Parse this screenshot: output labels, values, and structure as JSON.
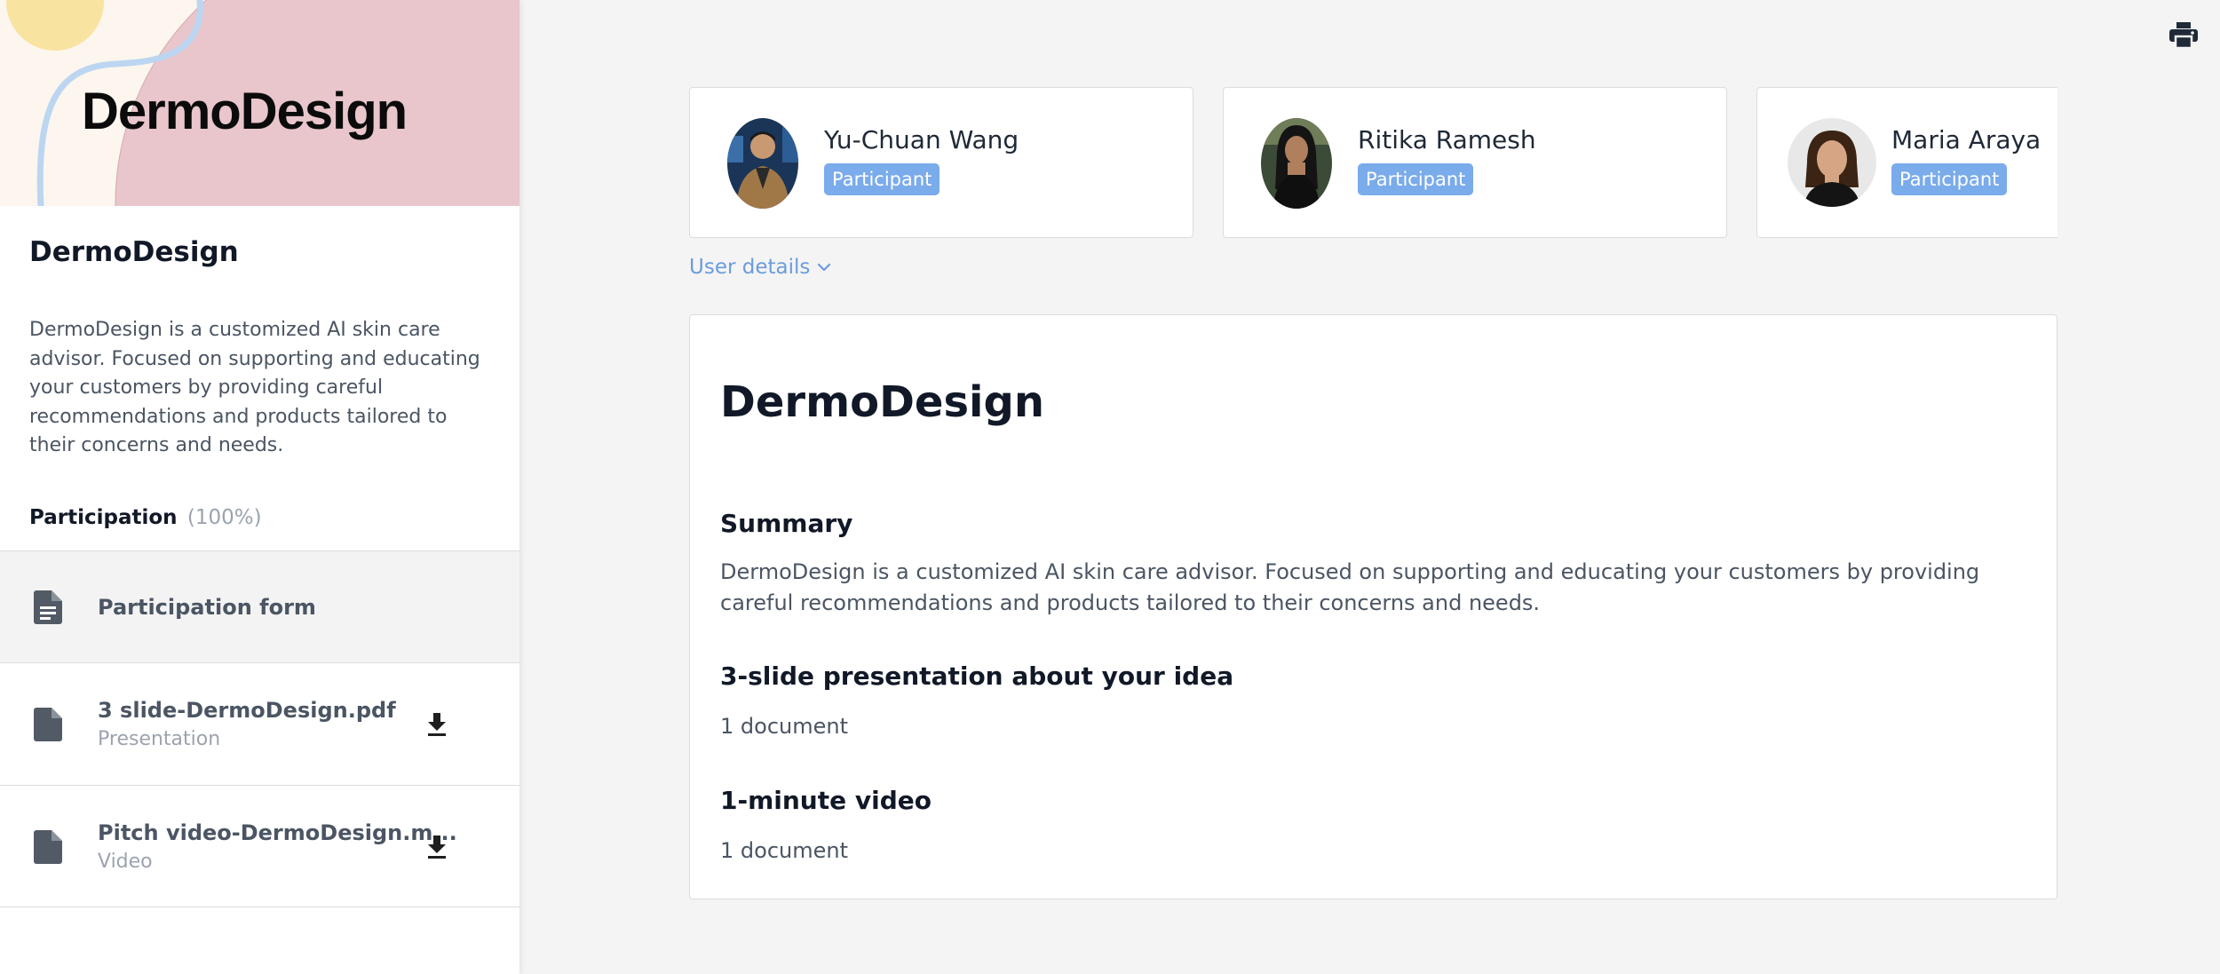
{
  "sidebar": {
    "hero_title": "DermoDesign",
    "title": "DermoDesign",
    "description": "DermoDesign is a customized AI skin care advisor. Focused on supporting and educating your customers by providing careful recommendations and products tailored to their concerns and needs.",
    "participation_label": "Participation",
    "participation_percent": "(100%)",
    "items": [
      {
        "title": "Participation form",
        "subtitle": "",
        "icon": "document-icon",
        "active": true
      },
      {
        "title": "3 slide-DermoDesign.pdf",
        "subtitle": "Presentation",
        "icon": "file-icon",
        "action_icon": "download-icon"
      },
      {
        "title": "Pitch video-DermoDesign.m...",
        "subtitle": "Video",
        "icon": "file-icon",
        "action_icon": "download-icon"
      }
    ]
  },
  "toolbar": {
    "print_icon": "print-icon"
  },
  "users": [
    {
      "name": "Yu-Chuan Wang",
      "role": "Participant"
    },
    {
      "name": "Ritika Ramesh",
      "role": "Participant"
    },
    {
      "name": "Maria Araya",
      "role": "Participant"
    }
  ],
  "user_details_label": "User details",
  "main": {
    "title": "DermoDesign",
    "sections": [
      {
        "heading": "Summary",
        "text": "DermoDesign is a customized AI skin care advisor. Focused on supporting and educating your customers by providing careful recommendations and products tailored to their concerns and needs."
      },
      {
        "heading": "3-slide presentation about your idea",
        "text": "1 document"
      },
      {
        "heading": "1-minute video",
        "text": "1 document"
      }
    ]
  },
  "colors": {
    "badge": "#7aabeb",
    "link": "#6b9cdc",
    "hero_pink": "#e8c6cc",
    "hero_yellow": "#f8e3a1",
    "hero_blue_line": "#bcd6f2"
  }
}
